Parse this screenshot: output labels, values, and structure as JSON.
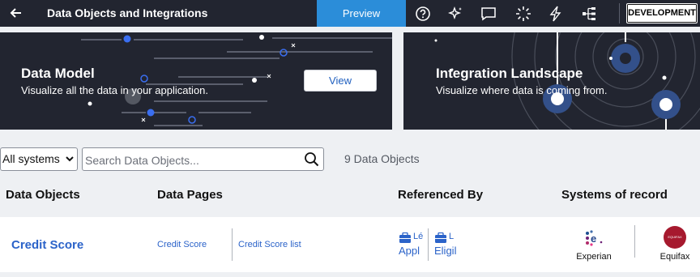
{
  "header": {
    "back_icon": "arrow-left-icon",
    "title": "Data Objects and Integrations",
    "preview_label": "Preview",
    "icons": [
      "help-icon",
      "sparkle-icon",
      "comment-icon",
      "loading-icon",
      "lightning-icon",
      "hierarchy-icon"
    ],
    "environment": "DEVELOPMENT"
  },
  "banners": {
    "data_model": {
      "title": "Data Model",
      "subtitle": "Visualize all the data in your application.",
      "view_label": "View"
    },
    "integration": {
      "title": "Integration Landscape",
      "subtitle": "Visualize where data is coming from."
    }
  },
  "filters": {
    "systems_value": "All systems",
    "search_placeholder": "Search Data Objects...",
    "count_text": "9 Data Objects"
  },
  "columns": [
    "Data Objects",
    "Data Pages",
    "Referenced By",
    "Systems of record"
  ],
  "rows": [
    {
      "name": "Credit Score",
      "pages": [
        "Credit Score",
        "Credit Score list"
      ],
      "referenced": [
        {
          "top": "Lé",
          "bottom": "Appl"
        },
        {
          "top": "L",
          "bottom": "Eligil"
        }
      ],
      "systems": [
        {
          "name": "Experian",
          "logo": "experian-logo"
        },
        {
          "name": "Equifax",
          "logo": "equifax-logo",
          "logo_text": "EQUIFAX"
        }
      ]
    }
  ],
  "colors": {
    "header_bg": "#222530",
    "accent": "#2b8dd9",
    "link": "#2b63c9",
    "equifax": "#a6192e"
  }
}
